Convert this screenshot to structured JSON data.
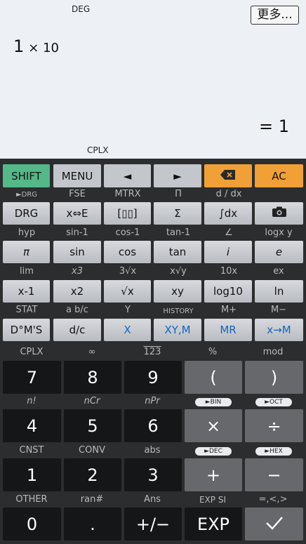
{
  "display": {
    "angle_mode": "DEG",
    "more_button": "更多...",
    "expression": {
      "mantissa": "1",
      "times_ten": "× 10"
    },
    "result": "= 1",
    "complex_mode": "CPLX"
  },
  "rows": {
    "r1": [
      {
        "name": "shift-key",
        "label": "SHIFT"
      },
      {
        "name": "menu-key",
        "label": "MENU"
      },
      {
        "name": "cursor-left-key",
        "label": "◄"
      },
      {
        "name": "cursor-right-key",
        "label": "►"
      },
      {
        "name": "backspace-key",
        "label": "⌫"
      },
      {
        "name": "all-clear-key",
        "label": "AC"
      }
    ],
    "r1_shift": [
      "►DRG",
      "FSE",
      "MTRX",
      "Π",
      "d / dx",
      ""
    ],
    "r2": [
      {
        "name": "drg-key",
        "label": "DRG"
      },
      {
        "name": "swap-key",
        "label": "x⇔E"
      },
      {
        "name": "matrix-key",
        "label": "[▯▯]"
      },
      {
        "name": "sum-key",
        "label": "Σ"
      },
      {
        "name": "integral-key",
        "label": "∫dx"
      },
      {
        "name": "camera-key",
        "label": "camera"
      }
    ],
    "r2_shift": [
      "hyp",
      "sin-1",
      "cos-1",
      "tan-1",
      "∠",
      "logx y"
    ],
    "r3": [
      {
        "name": "pi-key",
        "label": "π"
      },
      {
        "name": "sin-key",
        "label": "sin"
      },
      {
        "name": "cos-key",
        "label": "cos"
      },
      {
        "name": "tan-key",
        "label": "tan"
      },
      {
        "name": "imaginary-key",
        "label": "i"
      },
      {
        "name": "euler-key",
        "label": "e"
      }
    ],
    "r3_shift": [
      "lim",
      "x3",
      "3√x",
      "x√y",
      "10x",
      "ex"
    ],
    "r4": [
      {
        "name": "inverse-key",
        "label": "x-1"
      },
      {
        "name": "square-key",
        "label": "x2"
      },
      {
        "name": "sqrt-key",
        "label": "√x"
      },
      {
        "name": "power-key",
        "label": "xy"
      },
      {
        "name": "log10-key",
        "label": "log10"
      },
      {
        "name": "ln-key",
        "label": "ln"
      }
    ],
    "r4_shift": [
      "STAT",
      "a b/c",
      "Y",
      "HISTORY",
      "M+",
      "M−"
    ],
    "r5": [
      {
        "name": "dms-key",
        "label": "D°M'S"
      },
      {
        "name": "fraction-key",
        "label": "d/c"
      },
      {
        "name": "x-var-key",
        "label": "X"
      },
      {
        "name": "xym-key",
        "label": "XY,M"
      },
      {
        "name": "mr-key",
        "label": "MR"
      },
      {
        "name": "store-key",
        "label": "x→M"
      }
    ],
    "r5_shift": [
      "CPLX",
      "∞",
      "123",
      "%",
      "mod"
    ],
    "n1": [
      {
        "name": "digit-7-key",
        "label": "7"
      },
      {
        "name": "digit-8-key",
        "label": "8"
      },
      {
        "name": "digit-9-key",
        "label": "9"
      },
      {
        "name": "open-paren-key",
        "label": "("
      },
      {
        "name": "close-paren-key",
        "label": ")"
      }
    ],
    "n1_shift": [
      "n!",
      "nCr",
      "nPr"
    ],
    "n1_pills": [
      "►BIN",
      "►OCT"
    ],
    "n2": [
      {
        "name": "digit-4-key",
        "label": "4"
      },
      {
        "name": "digit-5-key",
        "label": "5"
      },
      {
        "name": "digit-6-key",
        "label": "6"
      },
      {
        "name": "multiply-key",
        "label": "×"
      },
      {
        "name": "divide-key",
        "label": "÷"
      }
    ],
    "n2_shift": [
      "CNST",
      "CONV",
      "abs"
    ],
    "n2_pills": [
      "►DEC",
      "►HEX"
    ],
    "n3": [
      {
        "name": "digit-1-key",
        "label": "1"
      },
      {
        "name": "digit-2-key",
        "label": "2"
      },
      {
        "name": "digit-3-key",
        "label": "3"
      },
      {
        "name": "plus-key",
        "label": "+"
      },
      {
        "name": "minus-key",
        "label": "−"
      }
    ],
    "n3_shift": [
      "OTHER",
      "ran#",
      "Ans",
      "EXP SI",
      "=,<,>"
    ],
    "n4": [
      {
        "name": "digit-0-key",
        "label": "0"
      },
      {
        "name": "decimal-key",
        "label": "."
      },
      {
        "name": "negate-key",
        "label": "+/−"
      },
      {
        "name": "exp-key",
        "label": "EXP"
      },
      {
        "name": "equals-key",
        "label": "✓"
      }
    ]
  },
  "colors": {
    "shift": "#55b888",
    "backspace": "#f0a036",
    "ac": "#f0a036",
    "blue_text": "#1565c0"
  }
}
